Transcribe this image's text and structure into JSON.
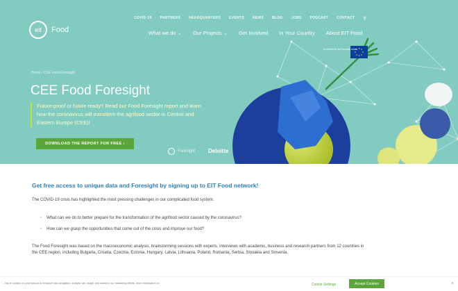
{
  "header": {
    "logo": {
      "mark": "eit",
      "name": "Food"
    },
    "top_links": [
      "COVID-19",
      "PARTNERS",
      "HEADQUARTERS",
      "EVENTS",
      "NEWS",
      "BLOG",
      "JOBS",
      "PODCAST",
      "CONTACT"
    ],
    "main_nav": [
      "What we do ⌄",
      "Our Projects ⌄",
      "Get Involved",
      "In Your Country",
      "About EIT Food"
    ]
  },
  "hero": {
    "breadcrumb": "Home › CEE Food Foresight",
    "title": "CEE Food Foresight",
    "intro": "Future-proof or future ready? Read our Food Foresight report and learn how the coronavirus will transform the agrifood sector in Central and Eastern Europe (CEE)!",
    "cta_label": "DOWNLOAD THE REPORT FOR FREE  ›",
    "partner_1": "Foresight",
    "partner_2": "Deloitte",
    "eu_caption": "Co-funded by the European Union"
  },
  "content": {
    "heading": "Get free access to unique data and Foresight by signing up to EIT Food network!",
    "paragraph_1": "The COVID-19 crisis has highlighted the most pressing challenges in our complicated food system.",
    "bullets": [
      "What can we do to better prepare for the transformation of the agrifood sector caused by the coronavirus?",
      "How can we grasp the opportunities that come out of the crisis and improve our food?"
    ],
    "paragraph_2": "The Food Foresight was based on the macroeconomic analysis, brainstorming sessions with experts, interviews with academic, business and research partners from 12 countries in the CEE region, including Bulgaria, Croatia, Czechia, Estonia, Hungary, Latvia, Lithuania, Poland, Romania, Serbia, Slovakia and Slovenia."
  },
  "cookie": {
    "text": "...ing of cookies on your device to enhance site navigation, analyse site usage, and assist in our marketing efforts. More information on",
    "settings_label": "Cookie Settings",
    "accept_label": "Accept Cookies",
    "close_label": "×"
  },
  "colors": {
    "hero_bg": "#82cbc0",
    "accent_green": "#5aa63b",
    "heading_blue": "#2e7fb6",
    "dark_blue": "#1c3f9e"
  }
}
